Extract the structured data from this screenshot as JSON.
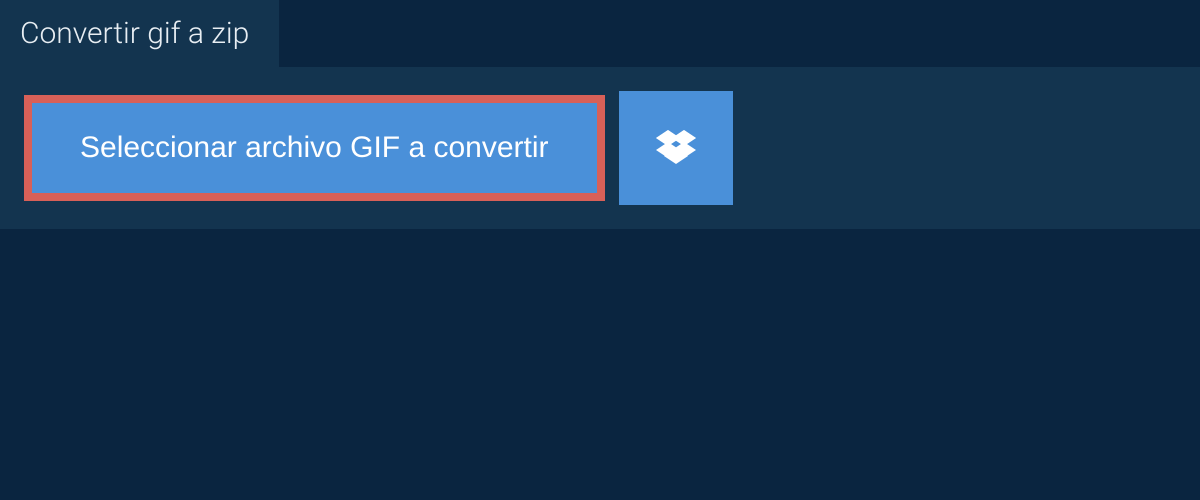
{
  "tab": {
    "title": "Convertir gif a zip"
  },
  "actions": {
    "select_file_label": "Seleccionar archivo GIF a convertir"
  }
}
